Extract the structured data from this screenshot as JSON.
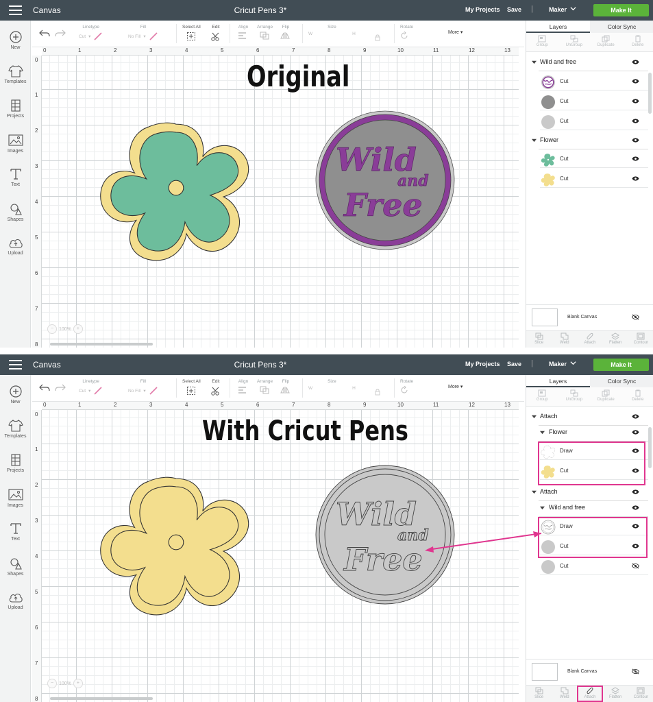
{
  "topbar": {
    "canvas_label": "Canvas",
    "project_name": "Cricut Pens 3*",
    "my_projects": "My Projects",
    "save": "Save",
    "separator": "|",
    "machine": "Maker",
    "make_it": "Make It"
  },
  "sidebar": {
    "items": [
      {
        "label": "New",
        "icon": "plus-circle-icon"
      },
      {
        "label": "Templates",
        "icon": "shirt-icon"
      },
      {
        "label": "Projects",
        "icon": "projects-icon"
      },
      {
        "label": "Images",
        "icon": "image-icon"
      },
      {
        "label": "Text",
        "icon": "text-icon"
      },
      {
        "label": "Shapes",
        "icon": "shapes-icon"
      },
      {
        "label": "Upload",
        "icon": "upload-cloud-icon"
      }
    ]
  },
  "editbar": {
    "linetype": "Linetype",
    "linetype_value": "Cut",
    "fill": "Fill",
    "fill_value": "No Fill",
    "select_all": "Select All",
    "edit": "Edit",
    "align": "Align",
    "arrange": "Arrange",
    "flip": "Flip",
    "size": "Size",
    "w": "W",
    "h": "H",
    "rotate": "Rotate",
    "more": "More"
  },
  "canvas": {
    "ruler_top": [
      "0",
      "1",
      "2",
      "3",
      "4",
      "5",
      "6",
      "7",
      "8",
      "9",
      "10",
      "11",
      "12",
      "13"
    ],
    "ruler_left": [
      "0",
      "1",
      "2",
      "3",
      "4",
      "5",
      "6",
      "7",
      "8"
    ],
    "zoom_value": "100%",
    "zoom_minus": "−",
    "zoom_plus": "+"
  },
  "layers_panel": {
    "tab_layers": "Layers",
    "tab_color_sync": "Color Sync",
    "top_tools": [
      "Group",
      "UnGroup",
      "Duplicate",
      "Delete"
    ],
    "bottom_tools": [
      "Slice",
      "Weld",
      "Attach",
      "Flatten",
      "Contour"
    ],
    "blank_canvas": "Blank Canvas"
  },
  "top_panel": {
    "heading": "Original",
    "layers": [
      {
        "type": "group",
        "label": "Wild and free"
      },
      {
        "type": "child",
        "label": "Cut",
        "thumb": "wild-free-purple"
      },
      {
        "type": "child",
        "label": "Cut",
        "thumb": "circle-dark-gray"
      },
      {
        "type": "child",
        "label": "Cut",
        "thumb": "circle-light-gray"
      },
      {
        "type": "group",
        "label": "Flower"
      },
      {
        "type": "child",
        "label": "Cut",
        "thumb": "flower-green"
      },
      {
        "type": "child",
        "label": "Cut",
        "thumb": "flower-yellow"
      }
    ]
  },
  "bottom_panel": {
    "heading": "With Cricut Pens",
    "layers": [
      {
        "type": "group",
        "label": "Attach"
      },
      {
        "type": "subgroup",
        "label": "Flower"
      },
      {
        "type": "child",
        "label": "Draw",
        "thumb": "flower-outline"
      },
      {
        "type": "child",
        "label": "Cut",
        "thumb": "flower-yellow"
      },
      {
        "type": "group",
        "label": "Attach"
      },
      {
        "type": "subgroup",
        "label": "Wild and free"
      },
      {
        "type": "child",
        "label": "Draw",
        "thumb": "wild-free-outline"
      },
      {
        "type": "child",
        "label": "Cut",
        "thumb": "circle-light-gray"
      },
      {
        "type": "child",
        "label": "Cut",
        "thumb": "circle-light-gray",
        "hidden": true
      }
    ]
  },
  "colors": {
    "topbar": "#414d55",
    "make_it": "#5bb33a",
    "flower_green": "#6dbd9c",
    "flower_yellow": "#f3de8e",
    "purple": "#8a3d98",
    "dark_gray": "#8f8f8f",
    "light_gray": "#c9c9c9",
    "highlight": "#e0368f"
  },
  "design_text": {
    "wild": "Wild",
    "and": "and",
    "free": "Free"
  }
}
